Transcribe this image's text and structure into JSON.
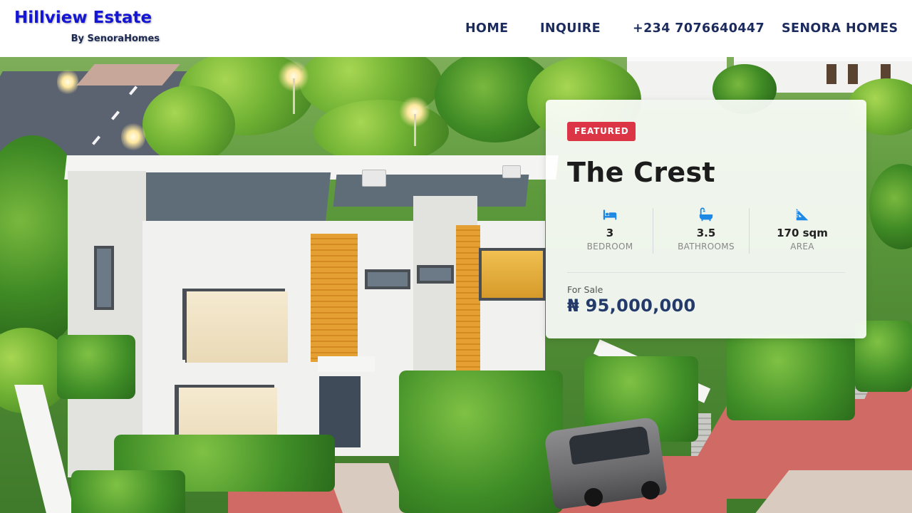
{
  "header": {
    "brand_title": "Hillview Estate",
    "brand_subtitle": "By SenoraHomes",
    "nav": {
      "home": "HOME",
      "inquire": "INQUIRE",
      "phone": "+234 7076640447",
      "senora_homes": "SENORA HOMES"
    }
  },
  "hero": {
    "image_subject": "aerial view of white duplex homes with orange wood panels, gardens and a parked car at dusk"
  },
  "card": {
    "badge": "FEATURED",
    "title": "The Crest",
    "stats": [
      {
        "icon": "bed-icon",
        "value": "3",
        "label": "BEDROOM"
      },
      {
        "icon": "bathtub-icon",
        "value": "3.5",
        "label": "BATHROOMS"
      },
      {
        "icon": "ruler-icon",
        "value": "170 sqm",
        "label": "AREA"
      }
    ],
    "price_label": "For Sale",
    "price": "₦ 95,000,000"
  },
  "colors": {
    "brand_title": "#1515d6",
    "nav_text": "#1b2b5e",
    "badge_bg": "#dc3545",
    "price_text": "#233a6b",
    "stat_icon": "#1e88e5"
  }
}
